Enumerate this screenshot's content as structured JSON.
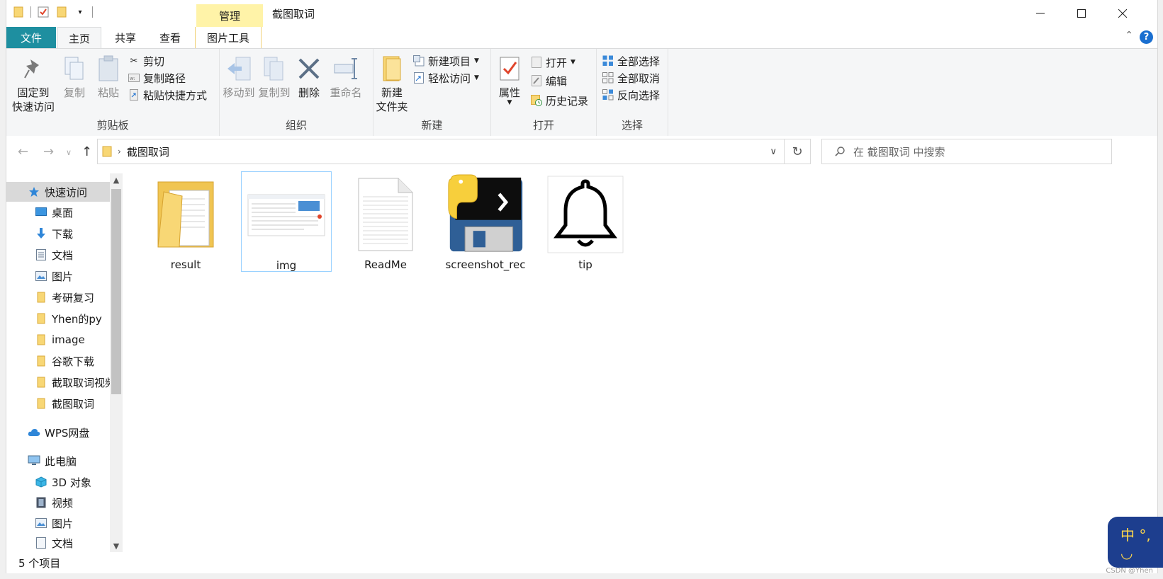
{
  "window": {
    "title": "截图取词",
    "context_group": "管理",
    "controls": [
      "—",
      "☐",
      "✕"
    ]
  },
  "tabs": {
    "file": "文件",
    "home": "主页",
    "share": "共享",
    "view": "查看",
    "picture_tools": "图片工具"
  },
  "ribbon": {
    "clipboard": {
      "label": "剪贴板",
      "pin_line1": "固定到",
      "pin_line2": "快速访问",
      "copy": "复制",
      "paste": "粘贴",
      "cut": "剪切",
      "copy_path": "复制路径",
      "paste_shortcut": "粘贴快捷方式"
    },
    "organize": {
      "label": "组织",
      "move_to": "移动到",
      "copy_to": "复制到",
      "delete": "删除",
      "rename": "重命名"
    },
    "new": {
      "label": "新建",
      "new_folder_line1": "新建",
      "new_folder_line2": "文件夹",
      "new_item": "新建项目",
      "easy_access": "轻松访问"
    },
    "open": {
      "label": "打开",
      "properties": "属性",
      "open": "打开",
      "edit": "编辑",
      "history": "历史记录"
    },
    "select": {
      "label": "选择",
      "select_all": "全部选择",
      "select_none": "全部取消",
      "invert": "反向选择"
    }
  },
  "address": {
    "path": "截图取词",
    "search_placeholder": "在 截图取词 中搜索"
  },
  "nav_pane": {
    "quick_access": "快速访问",
    "items": [
      {
        "label": "桌面",
        "pinned": true
      },
      {
        "label": "下载",
        "pinned": true
      },
      {
        "label": "文档",
        "pinned": true
      },
      {
        "label": "图片",
        "pinned": true
      },
      {
        "label": "考研复习",
        "pinned": true
      },
      {
        "label": "Yhen的py",
        "pinned": true
      },
      {
        "label": "image",
        "pinned": false
      },
      {
        "label": "谷歌下载",
        "pinned": false
      },
      {
        "label": "截取取词视频",
        "pinned": false
      },
      {
        "label": "截图取词",
        "pinned": false
      }
    ],
    "wps": "WPS网盘",
    "this_pc": "此电脑",
    "pc_items": [
      "3D 对象",
      "视频",
      "图片",
      "文档"
    ]
  },
  "files": [
    {
      "name": "result",
      "type": "folder"
    },
    {
      "name": "img",
      "type": "image"
    },
    {
      "name": "ReadMe",
      "type": "text"
    },
    {
      "name": "screenshot_rec",
      "type": "python"
    },
    {
      "name": "tip",
      "type": "bell"
    }
  ],
  "status": {
    "count": "5 个项目"
  },
  "ime": {
    "label": "中 °, ◡"
  },
  "watermark": "CSDN @Yhen"
}
